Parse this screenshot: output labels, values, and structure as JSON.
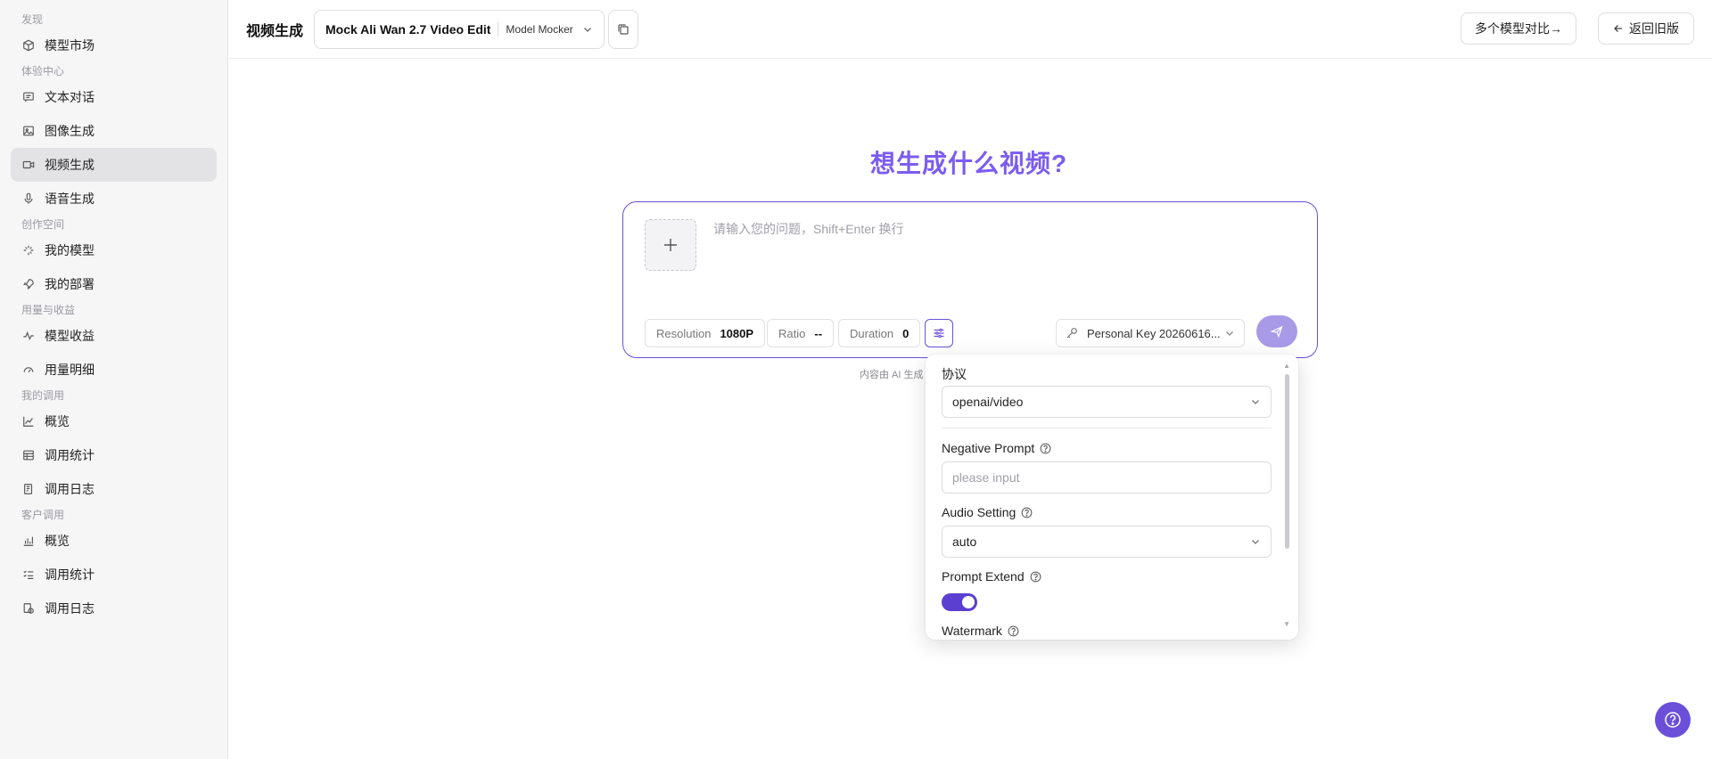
{
  "sidebar": {
    "sections": [
      {
        "title": "发现",
        "items": [
          {
            "label": "模型市场",
            "icon": "cube-icon"
          }
        ]
      },
      {
        "title": "体验中心",
        "items": [
          {
            "label": "文本对话",
            "icon": "chat-icon"
          },
          {
            "label": "图像生成",
            "icon": "image-icon"
          },
          {
            "label": "视频生成",
            "icon": "video-icon",
            "active": true
          },
          {
            "label": "语音生成",
            "icon": "mic-icon"
          }
        ]
      },
      {
        "title": "创作空间",
        "items": [
          {
            "label": "我的模型",
            "icon": "sparkle-icon"
          },
          {
            "label": "我的部署",
            "icon": "rocket-icon"
          }
        ]
      },
      {
        "title": "用量与收益",
        "items": [
          {
            "label": "模型收益",
            "icon": "pulse-icon"
          },
          {
            "label": "用量明细",
            "icon": "gauge-icon"
          }
        ]
      },
      {
        "title": "我的调用",
        "items": [
          {
            "label": "概览",
            "icon": "line-chart-icon"
          },
          {
            "label": "调用统计",
            "icon": "table-icon"
          },
          {
            "label": "调用日志",
            "icon": "log-icon"
          }
        ]
      },
      {
        "title": "客户调用",
        "items": [
          {
            "label": "概览",
            "icon": "bar-chart-icon"
          },
          {
            "label": "调用统计",
            "icon": "checklist-icon"
          },
          {
            "label": "调用日志",
            "icon": "clock-log-icon"
          }
        ]
      }
    ]
  },
  "header": {
    "title": "视频生成",
    "model_name": "Mock Ali Wan 2.7 Video Edit",
    "model_provider": "Model Mocker",
    "compare_label": "多个模型对比→",
    "back_label": "返回旧版"
  },
  "main": {
    "hero": "想生成什么视频?",
    "prompt_placeholder": "请输入您的问题，Shift+Enter 换行",
    "chips": [
      {
        "label": "Resolution",
        "value": "1080P"
      },
      {
        "label": "Ratio",
        "value": "--"
      },
      {
        "label": "Duration",
        "value": "0"
      }
    ],
    "api_key": "Personal Key 20260616...",
    "ai_note": "内容由 AI 生成"
  },
  "popover": {
    "protocol_label": "协议",
    "protocol_value": "openai/video",
    "negative_label": "Negative Prompt",
    "negative_placeholder": "please input",
    "audio_label": "Audio Setting",
    "audio_value": "auto",
    "extend_label": "Prompt Extend",
    "extend_on": true,
    "watermark_label": "Watermark"
  },
  "colors": {
    "accent": "#6b4fd8",
    "hero": "#7b5cf0"
  }
}
